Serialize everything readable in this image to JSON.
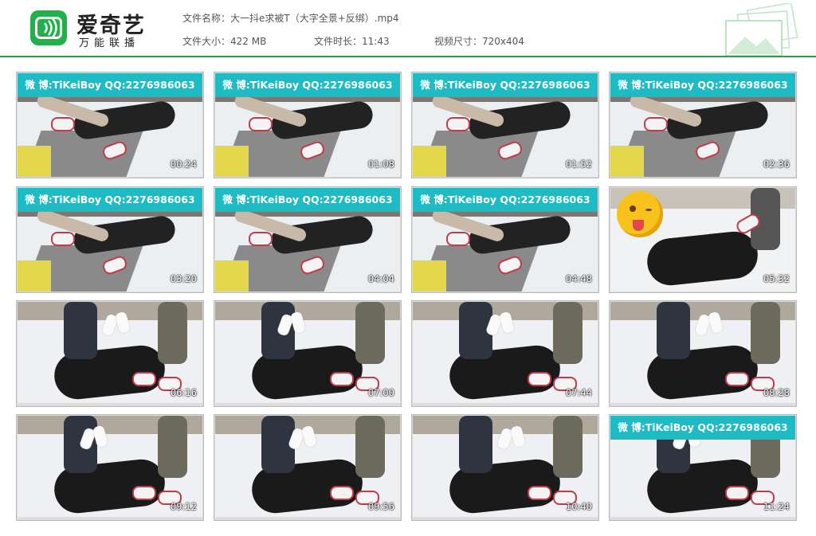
{
  "header": {
    "logo_title": "爱奇艺",
    "logo_subtitle": "万能联播",
    "file_name_label": "文件名称：",
    "file_name": "大一抖e求被T（大字全景+反绑）.mp4",
    "file_size_label": "文件大小：",
    "file_size": "422 MB",
    "duration_label": "文件时长：",
    "duration": "11:43",
    "resolution_label": "视频尺寸：",
    "resolution": "720x404",
    "accent_color": "#25a244"
  },
  "watermark_text": "微 博:TiKeiBoy  QQ:2276986063",
  "thumbnails": [
    {
      "time": "00:24",
      "watermark": true,
      "scene": "bed-wide"
    },
    {
      "time": "01:08",
      "watermark": true,
      "scene": "bed-wide"
    },
    {
      "time": "01:52",
      "watermark": true,
      "scene": "bed-wide"
    },
    {
      "time": "02:36",
      "watermark": true,
      "scene": "bed-wide"
    },
    {
      "time": "03:20",
      "watermark": true,
      "scene": "bed-wide"
    },
    {
      "time": "04:04",
      "watermark": true,
      "scene": "bed-wide"
    },
    {
      "time": "04:48",
      "watermark": true,
      "scene": "bed-wide"
    },
    {
      "time": "05:32",
      "watermark": false,
      "scene": "emoji"
    },
    {
      "time": "06:16",
      "watermark": false,
      "scene": "closeup"
    },
    {
      "time": "07:00",
      "watermark": false,
      "scene": "closeup"
    },
    {
      "time": "07:44",
      "watermark": false,
      "scene": "closeup"
    },
    {
      "time": "08:28",
      "watermark": false,
      "scene": "closeup"
    },
    {
      "time": "09:12",
      "watermark": false,
      "scene": "closeup"
    },
    {
      "time": "09:56",
      "watermark": false,
      "scene": "closeup"
    },
    {
      "time": "10:40",
      "watermark": false,
      "scene": "closeup"
    },
    {
      "time": "11:24",
      "watermark": true,
      "scene": "closeup"
    }
  ]
}
